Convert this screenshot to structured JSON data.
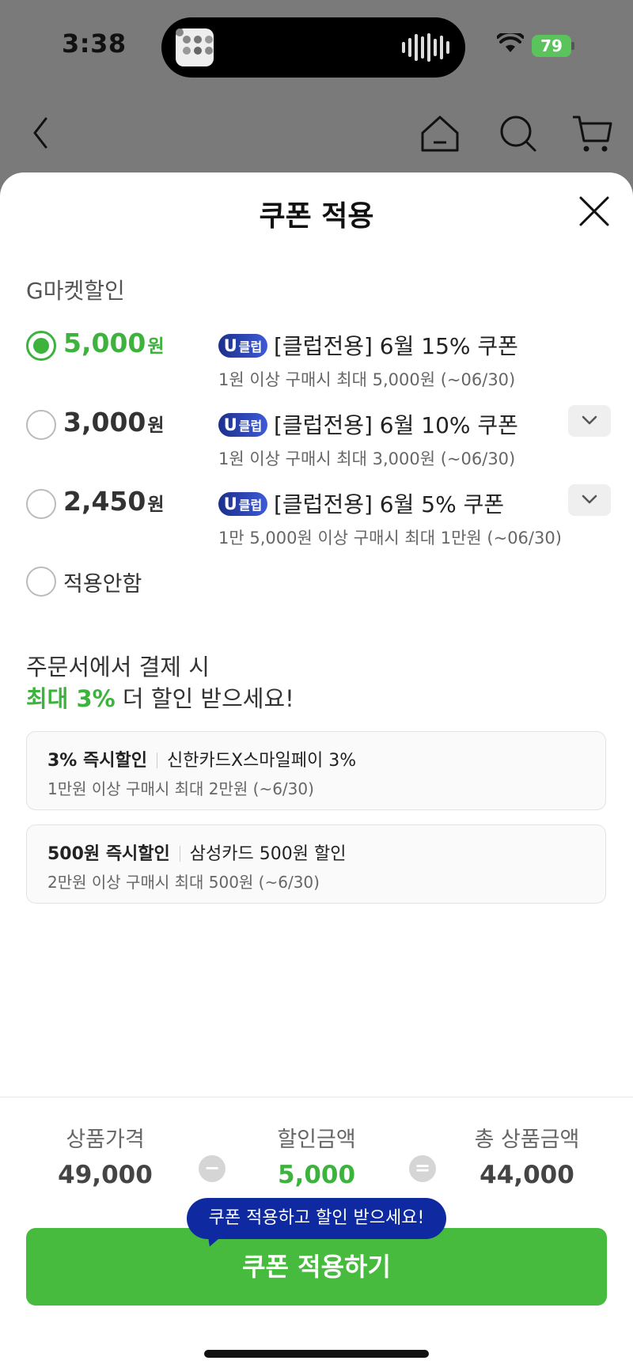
{
  "status_bar": {
    "time": "3:38",
    "battery": "79"
  },
  "sheet": {
    "title": "쿠폰 적용"
  },
  "gmarket_section": {
    "label": "G마켓할인"
  },
  "coupons": [
    {
      "amount": "5,000",
      "unit": "원",
      "badge_u": "U",
      "badge_text": "클럽",
      "name": "[클럽전용] 6월 15% 쿠폰",
      "desc": "1원 이상 구매시 최대 5,000원 (~06/30)",
      "selected": true
    },
    {
      "amount": "3,000",
      "unit": "원",
      "badge_u": "U",
      "badge_text": "클럽",
      "name": "[클럽전용] 6월 10% 쿠폰",
      "desc": "1원 이상 구매시 최대 3,000원 (~06/30)",
      "selected": false
    },
    {
      "amount": "2,450",
      "unit": "원",
      "badge_u": "U",
      "badge_text": "클럽",
      "name": "[클럽전용] 6월 5% 쿠폰",
      "desc": "1만 5,000원 이상 구매시 최대 1만원 (~06/30)",
      "selected": false
    }
  ],
  "no_apply_label": "적용안함",
  "promo": {
    "line1": "주문서에서 결제 시",
    "highlight": "최대 3%",
    "line2_rest": " 더 할인 받으세요!"
  },
  "card_offers": [
    {
      "title": "3% 즉시할인",
      "card": "신한카드X스마일페이 3%",
      "desc": "1만원 이상 구매시 최대 2만원 (~6/30)"
    },
    {
      "title": "500원 즉시할인",
      "card": "삼성카드 500원 할인",
      "desc": "2만원 이상 구매시 최대 500원 (~6/30)"
    }
  ],
  "summary": {
    "price_label": "상품가격",
    "price": "49,000",
    "minus": "−",
    "discount_label": "할인금액",
    "discount": "5,000",
    "equals": "=",
    "total_label": "총 상품금액",
    "total": "44,000"
  },
  "tooltip": "쿠폰 적용하고 할인 받으세요!",
  "apply_button": "쿠폰 적용하기",
  "colors": {
    "accent_green": "#3db23d",
    "button_green": "#47bb3d",
    "tooltip_blue": "#0f2aa0"
  }
}
